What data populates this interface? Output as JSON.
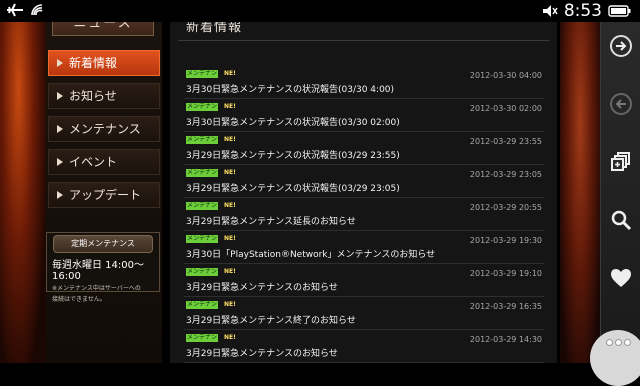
{
  "status": {
    "time": "8:53"
  },
  "sidebar": {
    "header": "ニュース",
    "items": [
      {
        "label": "新着情報",
        "active": true
      },
      {
        "label": "お知らせ",
        "active": false
      },
      {
        "label": "メンテナンス",
        "active": false
      },
      {
        "label": "イベント",
        "active": false
      },
      {
        "label": "アップデート",
        "active": false
      }
    ],
    "maintenance": {
      "title": "定期メンテナンス",
      "time": "毎週水曜日 14:00～16:00",
      "note_line1": "※メンテナンス中はサーバーへの",
      "note_line2": "接続はできません。"
    }
  },
  "main": {
    "title": "新着情報",
    "entries": [
      {
        "badge": "メンテナンス",
        "new": "NE!",
        "date": "2012-03-30 04:00",
        "title": "3月30日緊急メンテナンスの状況報告(03/30 4:00)"
      },
      {
        "badge": "メンテナンス",
        "new": "NE!",
        "date": "2012-03-30 02:00",
        "title": "3月30日緊急メンテナンスの状況報告(03/30 02:00)"
      },
      {
        "badge": "メンテナンス",
        "new": "NE!",
        "date": "2012-03-29 23:55",
        "title": "3月29日緊急メンテナンスの状況報告(03/29 23:55)"
      },
      {
        "badge": "メンテナンス",
        "new": "NE!",
        "date": "2012-03-29 23:05",
        "title": "3月29日緊急メンテナンスの状況報告(03/29 23:05)"
      },
      {
        "badge": "メンテナンス",
        "new": "NE!",
        "date": "2012-03-29 20:55",
        "title": "3月29日緊急メンテナンス延長のお知らせ"
      },
      {
        "badge": "メンテナンス",
        "new": "NE!",
        "date": "2012-03-29 19:30",
        "title": "3月30日「PlayStation®Network」メンテナンスのお知らせ"
      },
      {
        "badge": "メンテナンス",
        "new": "NE!",
        "date": "2012-03-29 19:10",
        "title": "3月29日緊急メンテナンスのお知らせ"
      },
      {
        "badge": "メンテナンス",
        "new": "NE!",
        "date": "2012-03-29 16:35",
        "title": "3月29日緊急メンテナンス終了のお知らせ"
      },
      {
        "badge": "メンテナンス",
        "new": "NE!",
        "date": "2012-03-29 14:30",
        "title": "3月29日緊急メンテナンスのお知らせ"
      }
    ]
  },
  "controls": {
    "icons": [
      "forward-icon",
      "back-icon",
      "windows-icon",
      "search-icon",
      "heart-icon",
      "more-icon"
    ]
  }
}
